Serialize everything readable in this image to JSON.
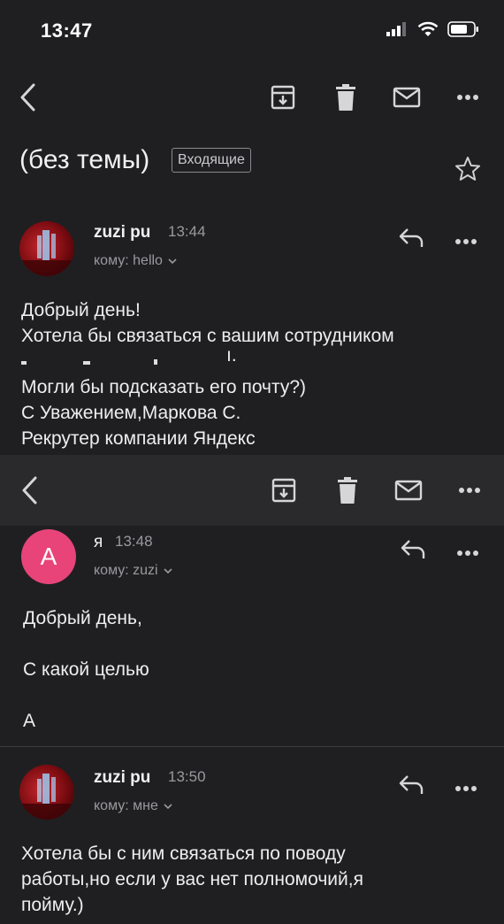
{
  "status_bar": {
    "time": "13:47"
  },
  "toolbar": {
    "icons": [
      "back-icon",
      "archive-icon",
      "trash-icon",
      "mail-icon",
      "more-icon"
    ]
  },
  "thread": {
    "subject": "(без темы)",
    "label": "Входящие"
  },
  "messages": [
    {
      "sender": "zuzi pu",
      "time": "13:44",
      "to": "кому: hello",
      "body": "Добрый день!\nХотела бы связаться с вашим сотрудником\n\nМогли бы подсказать его почту?)\nС Уважением,Маркова С.\nРекрутер компании Яндекс",
      "redacted_tail": "ı."
    },
    {
      "sender": "я",
      "avatar_letter": "А",
      "time": "13:48",
      "to": "кому: zuzi",
      "body": "Добрый день,\n\nС какой целью\n\nА"
    },
    {
      "sender": "zuzi pu",
      "time": "13:50",
      "to": "кому: мне",
      "body": "Хотела бы с ним связаться по поводу\nработы,но если у вас нет полномочий,я\nпойму.)"
    }
  ],
  "colors": {
    "background": "#1f1f21",
    "avatar_me": "#e8447a",
    "text": "#eeeeef",
    "muted": "#9a9a9e"
  }
}
